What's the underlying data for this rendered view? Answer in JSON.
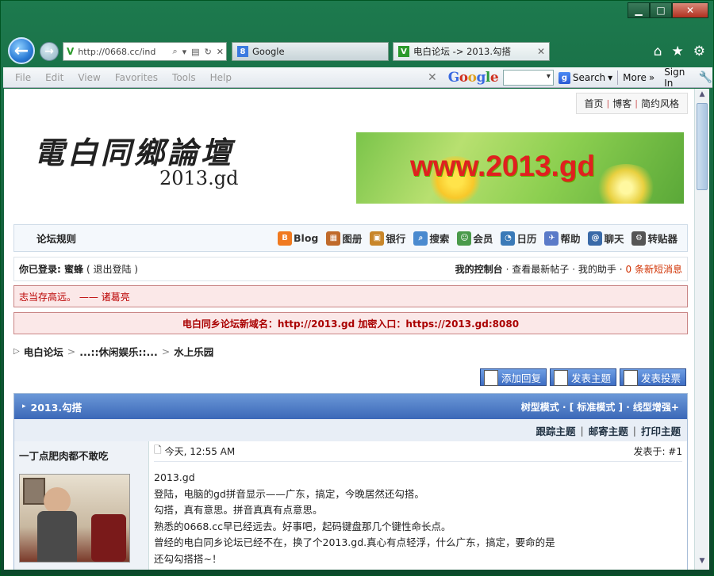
{
  "browser": {
    "address": "http://0668.cc/ind",
    "tabs": [
      {
        "label": "Google",
        "icon": "8"
      },
      {
        "label": "电白论坛 -> 2013.勾搭",
        "icon": "V"
      }
    ],
    "menu": [
      "File",
      "Edit",
      "View",
      "Favorites",
      "Tools",
      "Help"
    ],
    "google_logo": "Google",
    "search_label": "Search",
    "more_label": "More",
    "signin_label": "Sign In"
  },
  "site": {
    "toplinks": [
      "首页",
      "博客",
      "简约风格"
    ],
    "logo_cn": "電白同鄉論壇",
    "logo_en": "2013.gd",
    "banner_text": "www.2013.gd",
    "nav_rules": "论坛规则",
    "nav": [
      {
        "label": "Blog",
        "color": "#f07a20",
        "glyph": "B"
      },
      {
        "label": "图册",
        "color": "#c06a2a",
        "glyph": "▦"
      },
      {
        "label": "银行",
        "color": "#c8862a",
        "glyph": "▣"
      },
      {
        "label": "搜索",
        "color": "#4a8acf",
        "glyph": "⌕"
      },
      {
        "label": "会员",
        "color": "#4a9a4a",
        "glyph": "☺"
      },
      {
        "label": "日历",
        "color": "#3a7ab8",
        "glyph": "◔"
      },
      {
        "label": "帮助",
        "color": "#5a7ac8",
        "glyph": "✈"
      },
      {
        "label": "聊天",
        "color": "#3a6aa8",
        "glyph": "@"
      },
      {
        "label": "转贴器",
        "color": "#555555",
        "glyph": "⚙"
      }
    ],
    "login_prefix": "你已登录: 蜜蜂",
    "logout": "( 退出登陆 )",
    "control": "我的控制台",
    "latest": "· 查看最新帖子",
    "assistant": "· 我的助手 ·",
    "new_msgs": "0 条新短消息",
    "quote": "志当存高远。 —— 诸葛亮",
    "domain_notice": "电白同乡论坛新域名：http://2013.gd 加密入口：https://2013.gd:8080",
    "crumb": [
      "电白论坛",
      ">",
      "...::休闲娱乐::...",
      ">",
      "水上乐园"
    ],
    "buttons": [
      "添加回复",
      "发表主题",
      "发表投票"
    ]
  },
  "thread": {
    "title": "2013.勾搭",
    "modes": "树型模式 · [ 标准模式 ] · 线型增强+",
    "tools": [
      "跟踪主题",
      "邮寄主题",
      "打印主题"
    ],
    "author": "一丁点肥肉都不敢吃",
    "time": "今天, 12:55 AM",
    "floor": "发表于: #1",
    "body": [
      "2013.gd",
      "登陆，电脑的gd拼音显示——广东，搞定，今晚居然还勾搭。",
      "勾搭，真有意思。拼音真真有点意思。",
      "熟悉的0668.cc早已经远去。好事吧，起码键盘那几个键性命长点。",
      "曾经的电白同乡论坛已经不在，换了个2013.gd.真心有点轻浮，什么广东，搞定，要命的是",
      "还勾勾搭搭~！"
    ]
  }
}
